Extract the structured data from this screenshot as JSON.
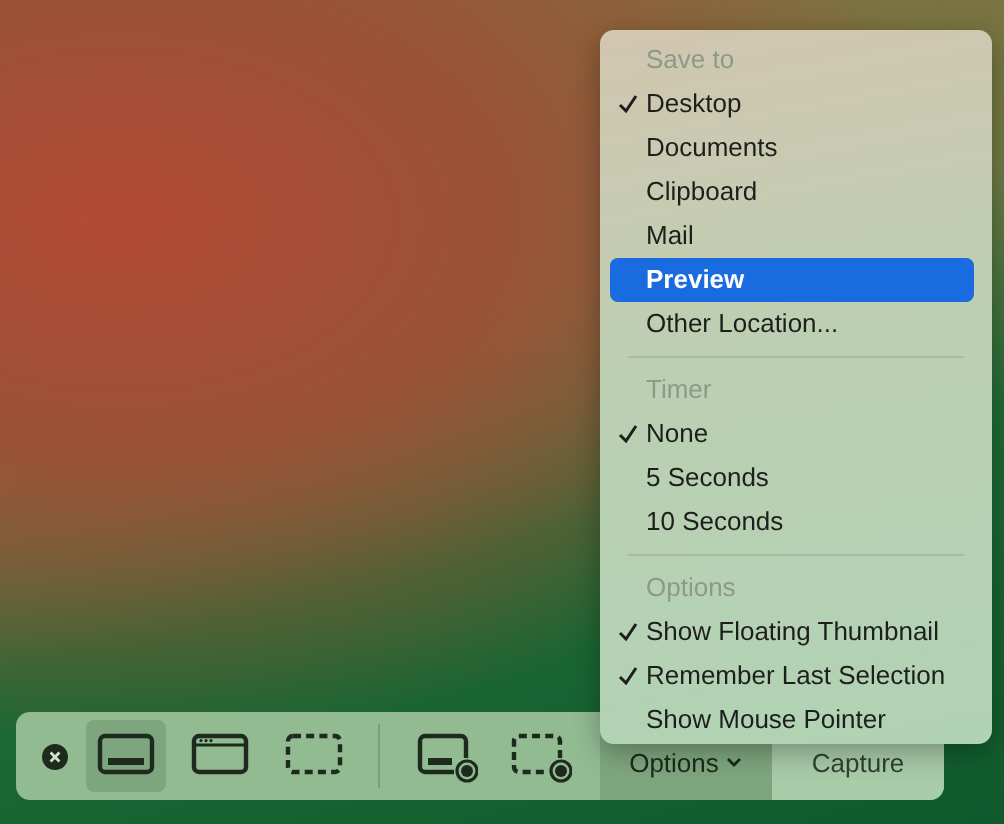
{
  "toolbar": {
    "modes": [
      {
        "kind": "screen",
        "selected": true
      },
      {
        "kind": "window",
        "selected": false
      },
      {
        "kind": "selection",
        "selected": false
      },
      {
        "kind": "record-screen",
        "selected": false
      },
      {
        "kind": "record-selection",
        "selected": false
      }
    ],
    "options_button": {
      "label": "Options",
      "expanded": true
    },
    "capture_button": {
      "label": "Capture"
    }
  },
  "menu": {
    "sections": [
      {
        "header": "Save to",
        "items": [
          {
            "label": "Desktop",
            "checked": true,
            "selected": false
          },
          {
            "label": "Documents",
            "checked": false,
            "selected": false
          },
          {
            "label": "Clipboard",
            "checked": false,
            "selected": false
          },
          {
            "label": "Mail",
            "checked": false,
            "selected": false
          },
          {
            "label": "Preview",
            "checked": false,
            "selected": true
          },
          {
            "label": "Other Location...",
            "checked": false,
            "selected": false
          }
        ]
      },
      {
        "header": "Timer",
        "items": [
          {
            "label": "None",
            "checked": true,
            "selected": false
          },
          {
            "label": "5 Seconds",
            "checked": false,
            "selected": false
          },
          {
            "label": "10 Seconds",
            "checked": false,
            "selected": false
          }
        ]
      },
      {
        "header": "Options",
        "items": [
          {
            "label": "Show Floating Thumbnail",
            "checked": true,
            "selected": false
          },
          {
            "label": "Remember Last Selection",
            "checked": true,
            "selected": false
          },
          {
            "label": "Show Mouse Pointer",
            "checked": false,
            "selected": false
          }
        ]
      }
    ]
  }
}
